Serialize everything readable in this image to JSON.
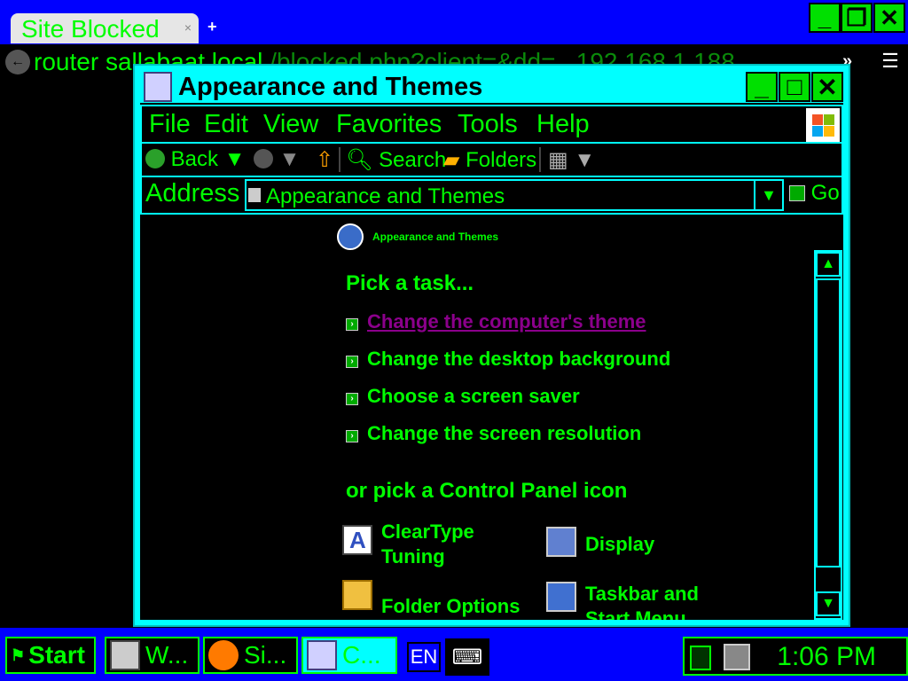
{
  "browser": {
    "tab_title": "Site Blocked",
    "tab_close": "×",
    "new_tab": "+",
    "url_main": "router",
    "url_host": "sallabaat.local",
    "url_rest": "/blocked.php?client=&dd=...192.168.1.188...",
    "more": "»",
    "menu": "☰"
  },
  "window": {
    "title": "Appearance and Themes",
    "minimize": "_",
    "maximize": "□",
    "close": "✕",
    "menu": [
      "File",
      "Edit",
      "View",
      "Favorites",
      "Tools",
      "Help"
    ],
    "toolbar": {
      "back": "Back",
      "search": "Search",
      "folders": "Folders"
    },
    "address_label": "Address",
    "address_value": "Appearance and Themes",
    "go": "Go"
  },
  "content": {
    "header": "Appearance and Themes",
    "pick_task": "Pick a task...",
    "tasks": [
      "Change the computer's theme",
      "Change the desktop background",
      "Choose a screen saver",
      "Change the screen resolution"
    ],
    "pick_icon": "or pick a Control Panel icon",
    "icons": [
      {
        "line1": "ClearType",
        "line2": "Tuning"
      },
      {
        "line1": "Display",
        "line2": ""
      },
      {
        "line1": "Folder Options",
        "line2": ""
      },
      {
        "line1": "Taskbar and",
        "line2": "Start Menu"
      }
    ]
  },
  "taskbar": {
    "start": "Start",
    "tasks": [
      "W...",
      "Si...",
      "C..."
    ],
    "lang": "EN",
    "clock": "1:06 PM"
  },
  "colors": {
    "fg": "#00ff00",
    "window_frame": "#00ffff",
    "taskbar": "#0000ff",
    "visited_link": "#8b008b"
  }
}
